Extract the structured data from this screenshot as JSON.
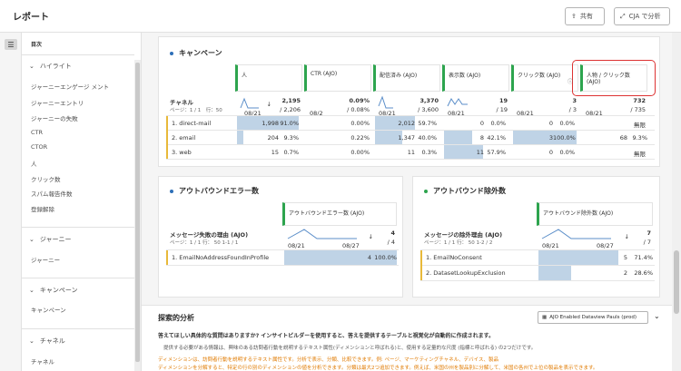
{
  "header": {
    "title": "レポート",
    "share_label": "共有",
    "cja_label": "CJA で分析"
  },
  "sidebar": {
    "title": "目次",
    "sections": [
      {
        "label": "ハイライト",
        "items": [
          "ジャーニーエンゲージ メント",
          "ジャーニーエントリ",
          "ジャーニーの失敗",
          "CTR",
          "CTOR",
          "人",
          "クリック数",
          "スパム報告件数",
          "登録解除"
        ]
      },
      {
        "label": "ジャーニー",
        "items": [
          "ジャーニー"
        ]
      },
      {
        "label": "キャンペーン",
        "items": [
          "キャンペーン"
        ]
      },
      {
        "label": "チャネル",
        "items": [
          "チャネル"
        ]
      }
    ]
  },
  "campaign": {
    "title": "キャンペーン",
    "dim_label": "チャネル",
    "page_info": "ページ：1 / 1　行：",
    "columns": [
      {
        "label": "人",
        "total": "2,195",
        "sub": "/ 2,206",
        "date": "08/21"
      },
      {
        "label": "CTR (AJO)",
        "total": "0.09%",
        "sub": "/ 0.08%",
        "date": "08/2"
      },
      {
        "label": "配信済み (AJO)",
        "total": "3,370",
        "sub": "/ 3,600",
        "date": "08/21"
      },
      {
        "label": "表示数 (AJO)",
        "total": "19",
        "sub": "/ 19",
        "date": "08/21"
      },
      {
        "label": "クリック数 (AJO)",
        "total": "3",
        "sub": "/ 3",
        "date": "08/21"
      },
      {
        "label": "人物 / クリック数 (AJO)",
        "total": "732",
        "sub": "/ 735",
        "date": "08/21"
      }
    ],
    "rows": [
      {
        "num": "1.",
        "name": "direct-mail",
        "c0": "1,998",
        "p0": "91.0%",
        "c1": "0.00%",
        "c2": "2,012",
        "p2": "59.7%",
        "c3": "0",
        "p3": "0.0%",
        "c4": "0",
        "p4": "0.0%",
        "c5": "無限"
      },
      {
        "num": "2.",
        "name": "email",
        "c0": "204",
        "p0": "9.3%",
        "c1": "0.22%",
        "c2": "1,347",
        "p2": "40.0%",
        "c3": "8",
        "p3": "42.1%",
        "c4": "3",
        "p4": "100.0%",
        "c5": "68",
        "p5": "9.3%"
      },
      {
        "num": "3.",
        "name": "web",
        "c0": "15",
        "p0": "0.7%",
        "c1": "0.00%",
        "c2": "11",
        "p2": "0.3%",
        "c3": "11",
        "p3": "57.9%",
        "c4": "0",
        "p4": "0.0%",
        "c5": "無限"
      }
    ],
    "rows_per_page": "50"
  },
  "outbound_error": {
    "title": "アウトバウンドエラー数",
    "col_label": "アウトバウンドエラー数 (AJO)",
    "dim_label": "メッセージ失敗の理由 (AJO)",
    "page_info": "ページ：1 / 1 行：",
    "rows_per_page": "50",
    "range": "1-1 / 1",
    "date_start": "08/21",
    "date_end": "08/27",
    "total": "4",
    "sub": "/ 4",
    "rows": [
      {
        "num": "1.",
        "name": "EmailNoAddressFoundInProfile",
        "value": "4",
        "pct": "100.0%"
      }
    ]
  },
  "outbound_excl": {
    "title": "アウトバウンド除外数",
    "col_label": "アウトバウンド除外数 (AJO)",
    "dim_label": "メッセージの除外理由 (AJO)",
    "page_info": "ページ：1 / 1 行：",
    "rows_per_page": "50",
    "range": "1-2 / 2",
    "date_start": "08/21",
    "date_end": "08/27",
    "total": "7",
    "sub": "/ 7",
    "rows": [
      {
        "num": "1.",
        "name": "EmailNoConsent",
        "value": "5",
        "pct": "71.4%"
      },
      {
        "num": "2.",
        "name": "DatasetLookupExclusion",
        "value": "2",
        "pct": "28.6%"
      }
    ]
  },
  "explore": {
    "title": "探索的分析",
    "dataview": "AJO Enabled Dataview Pauls (prod)",
    "question": "答えてほしい具体的な質問はありますか? インサイトビルダーを使用すると、答えを提供するテーブルと視覚化が自動的に作成されます。",
    "line1": "提供する必要がある情報は、興味のある訪問者行動を説明するテキスト属性(ディメンションと呼ばれる)と、使用する定量的な尺度 (指標と呼ばれる) の2つだけです。",
    "line2": "ディメンションは、訪問者行動を説明するテキスト属性です。分析で表示、分類、比較できます。例: ページ、マーケティングチャネル、デバイス、製品",
    "line3": "ディメンションを分解すると、特定の行の別のディメンションの値を分析できます。分類は最大2つ追加できます。例えば、米国の州を製品別に分解して、米国の各州で上位の製品を表示できます。"
  },
  "colors": {
    "accent_green": "#2da44e",
    "highlight_red": "#d33333",
    "bar_blue": "#bfd3e6",
    "row_marker": "#e8b93a"
  }
}
